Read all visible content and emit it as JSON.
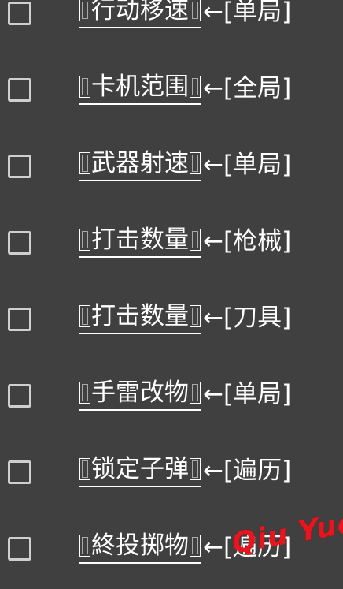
{
  "rows": [
    {
      "name": "行动移速",
      "scope": "单局",
      "checked": false
    },
    {
      "name": "卡机范围",
      "scope": "全局",
      "checked": false
    },
    {
      "name": "武器射速",
      "scope": "单局",
      "checked": false
    },
    {
      "name": "打击数量",
      "scope": "枪械",
      "checked": false
    },
    {
      "name": "打击数量",
      "scope": "刀具",
      "checked": false
    },
    {
      "name": "手雷改物",
      "scope": "单局",
      "checked": false
    },
    {
      "name": "锁定子弹",
      "scope": "遍历",
      "checked": false
    },
    {
      "name": "終投掷物",
      "scope": "遍历",
      "checked": false
    }
  ],
  "arrow_text": "←",
  "watermark": "Qiu Yue",
  "colors": {
    "background": "#404040",
    "text": "#ffffff",
    "checkbox_border": "#cfcfcf",
    "watermark": "#e8141e"
  }
}
